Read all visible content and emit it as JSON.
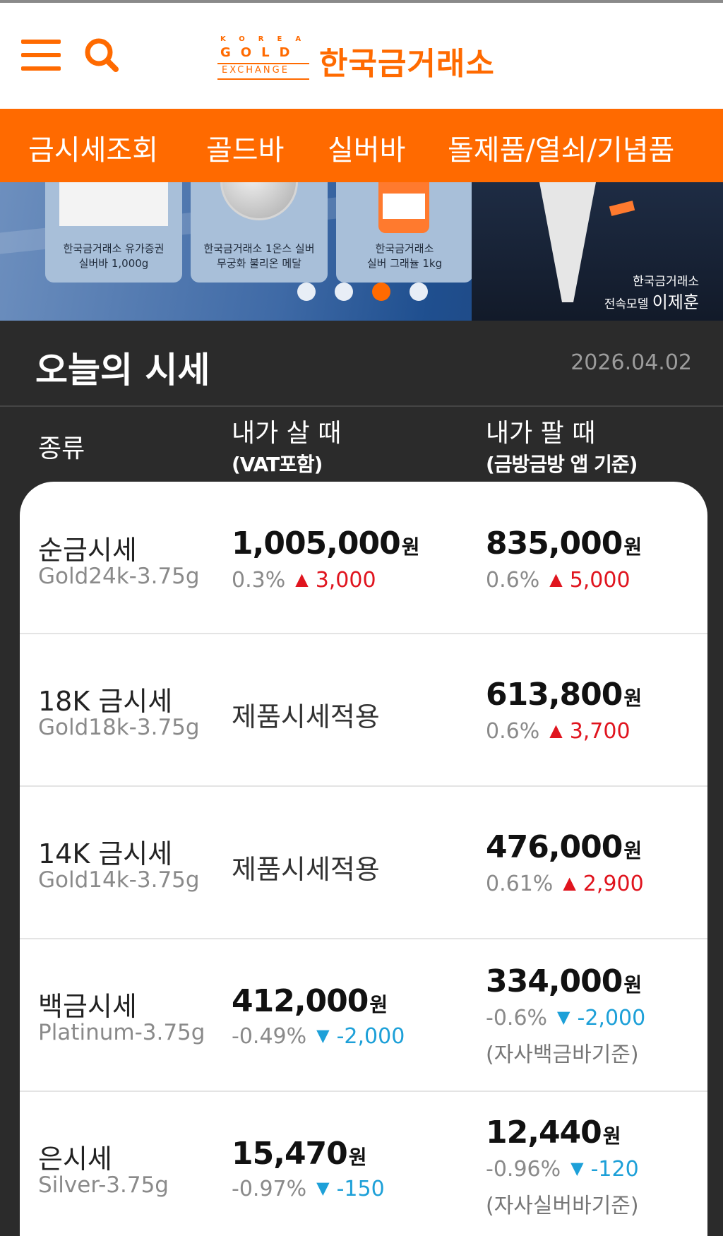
{
  "header": {
    "logo_korea": "KOREA",
    "logo_gold": "GOLD",
    "logo_exchange": "EXCHANGE",
    "logo_name": "한국금거래소",
    "menu_icon": "hamburger-menu-icon",
    "search_icon": "search-icon"
  },
  "nav": {
    "items": [
      {
        "label": "금시세조회"
      },
      {
        "label": "골드바"
      },
      {
        "label": "실버바"
      },
      {
        "label": "돌제품/열쇠/기념품"
      }
    ]
  },
  "banner": {
    "cards": [
      {
        "line1": "한국금거래소 유가증권",
        "line2": "실버바 1,000g"
      },
      {
        "line1": "한국금거래소 1온스 실버",
        "line2": "무궁화 불리온 메달"
      },
      {
        "line1": "한국금거래소",
        "line2": "실버 그래뉼 1kg"
      }
    ],
    "active_slide": 3,
    "slide_count": 4,
    "model_line1": "한국금거래소",
    "model_line2_prefix": "전속모델",
    "model_name": "이제훈"
  },
  "today": {
    "title": "오늘의 시세",
    "date": "2026.04.02"
  },
  "table": {
    "columns": {
      "type": "종류",
      "buy_title": "내가 살 때",
      "buy_sub": "(VAT포함)",
      "sell_title": "내가 팔 때",
      "sell_sub": "(금방금방 앱 기준)"
    },
    "currency_unit": "원",
    "rows": [
      {
        "name": "순금시세",
        "sub": "Gold24k-3.75g",
        "buy_price": "1,005,000",
        "buy_pct": "0.3%",
        "buy_dir": "up",
        "buy_delta": "3,000",
        "sell_price": "835,000",
        "sell_pct": "0.6%",
        "sell_dir": "up",
        "sell_delta": "5,000"
      },
      {
        "name": "18K 금시세",
        "sub": "Gold18k-3.75g",
        "buy_text": "제품시세적용",
        "sell_price": "613,800",
        "sell_pct": "0.6%",
        "sell_dir": "up",
        "sell_delta": "3,700"
      },
      {
        "name": "14K 금시세",
        "sub": "Gold14k-3.75g",
        "buy_text": "제품시세적용",
        "sell_price": "476,000",
        "sell_pct": "0.61%",
        "sell_dir": "up",
        "sell_delta": "2,900"
      },
      {
        "name": "백금시세",
        "sub": "Platinum-3.75g",
        "buy_price": "412,000",
        "buy_pct": "-0.49%",
        "buy_dir": "down",
        "buy_delta": "-2,000",
        "sell_price": "334,000",
        "sell_pct": "-0.6%",
        "sell_dir": "down",
        "sell_delta": "-2,000",
        "sell_note": "(자사백금바기준)"
      },
      {
        "name": "은시세",
        "sub": "Silver-3.75g",
        "buy_price": "15,470",
        "buy_pct": "-0.97%",
        "buy_dir": "down",
        "buy_delta": "-150",
        "sell_price": "12,440",
        "sell_pct": "-0.96%",
        "sell_dir": "down",
        "sell_delta": "-120",
        "sell_note": "(자사실버바기준)"
      }
    ]
  },
  "colors": {
    "brand": "#ff6a00",
    "up": "#e0141e",
    "down": "#1da0d8",
    "dark_bg": "#2b2b2b"
  }
}
